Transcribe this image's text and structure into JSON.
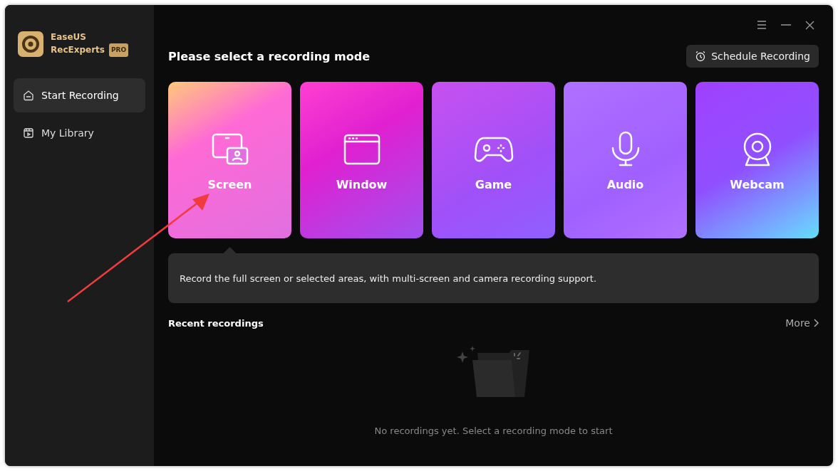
{
  "brand": {
    "name_line1": "EaseUS",
    "name_line2": "RecExperts",
    "badge": "PRO"
  },
  "sidebar": {
    "items": [
      {
        "label": "Start Recording",
        "selected": true
      },
      {
        "label": "My Library",
        "selected": false
      }
    ]
  },
  "heading": "Please select a recording mode",
  "schedule_button": "Schedule Recording",
  "modes": [
    {
      "label": "Screen",
      "selected": true
    },
    {
      "label": "Window",
      "selected": false
    },
    {
      "label": "Game",
      "selected": false
    },
    {
      "label": "Audio",
      "selected": false
    },
    {
      "label": "Webcam",
      "selected": false
    }
  ],
  "description": "Record the full screen or selected areas, with multi-screen and camera recording support.",
  "recent": {
    "title": "Recent recordings",
    "more": "More",
    "empty_text": "No recordings yet. Select a recording mode to start"
  }
}
